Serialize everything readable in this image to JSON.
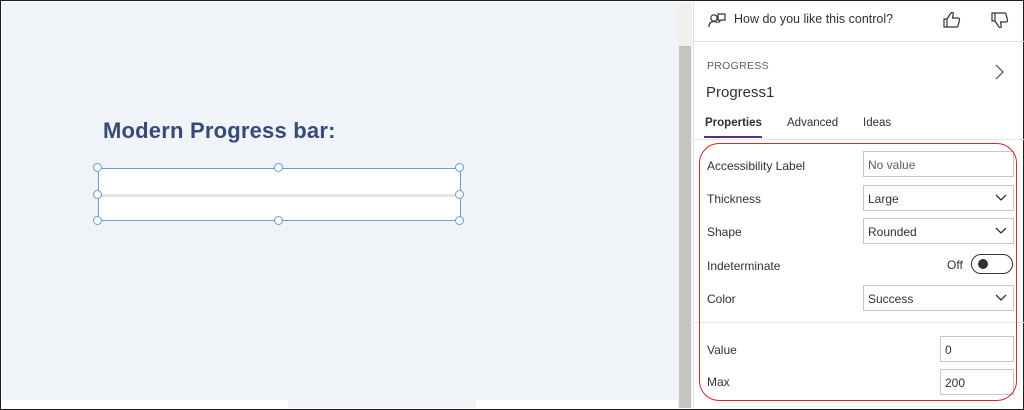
{
  "canvas": {
    "heading": "Modern Progress bar:",
    "progress": {
      "value": 0,
      "max": 200,
      "fill_color": "#107c10"
    }
  },
  "panel": {
    "feedback": {
      "text": "How do you like this control?",
      "icon": "feedback-icon",
      "thumbs_up_icon": "thumbs-up-icon",
      "thumbs_down_icon": "thumbs-down-icon"
    },
    "control_type": "PROGRESS",
    "control_name": "Progress1",
    "tabs": [
      {
        "label": "Properties",
        "active": true
      },
      {
        "label": "Advanced",
        "active": false
      },
      {
        "label": "Ideas",
        "active": false
      }
    ],
    "properties": {
      "accessibility_label": {
        "label": "Accessibility Label",
        "placeholder": "No value"
      },
      "thickness": {
        "label": "Thickness",
        "value": "Large"
      },
      "shape": {
        "label": "Shape",
        "value": "Rounded"
      },
      "indeterminate": {
        "label": "Indeterminate",
        "state": "Off"
      },
      "color": {
        "label": "Color",
        "value": "Success"
      },
      "value": {
        "label": "Value",
        "value": "0"
      },
      "max": {
        "label": "Max",
        "value": "200"
      }
    }
  },
  "colors": {
    "accent": "#5b2c83",
    "heading": "#364b7a",
    "selection": "#6a9bd6",
    "annotation": "#d9222a"
  }
}
